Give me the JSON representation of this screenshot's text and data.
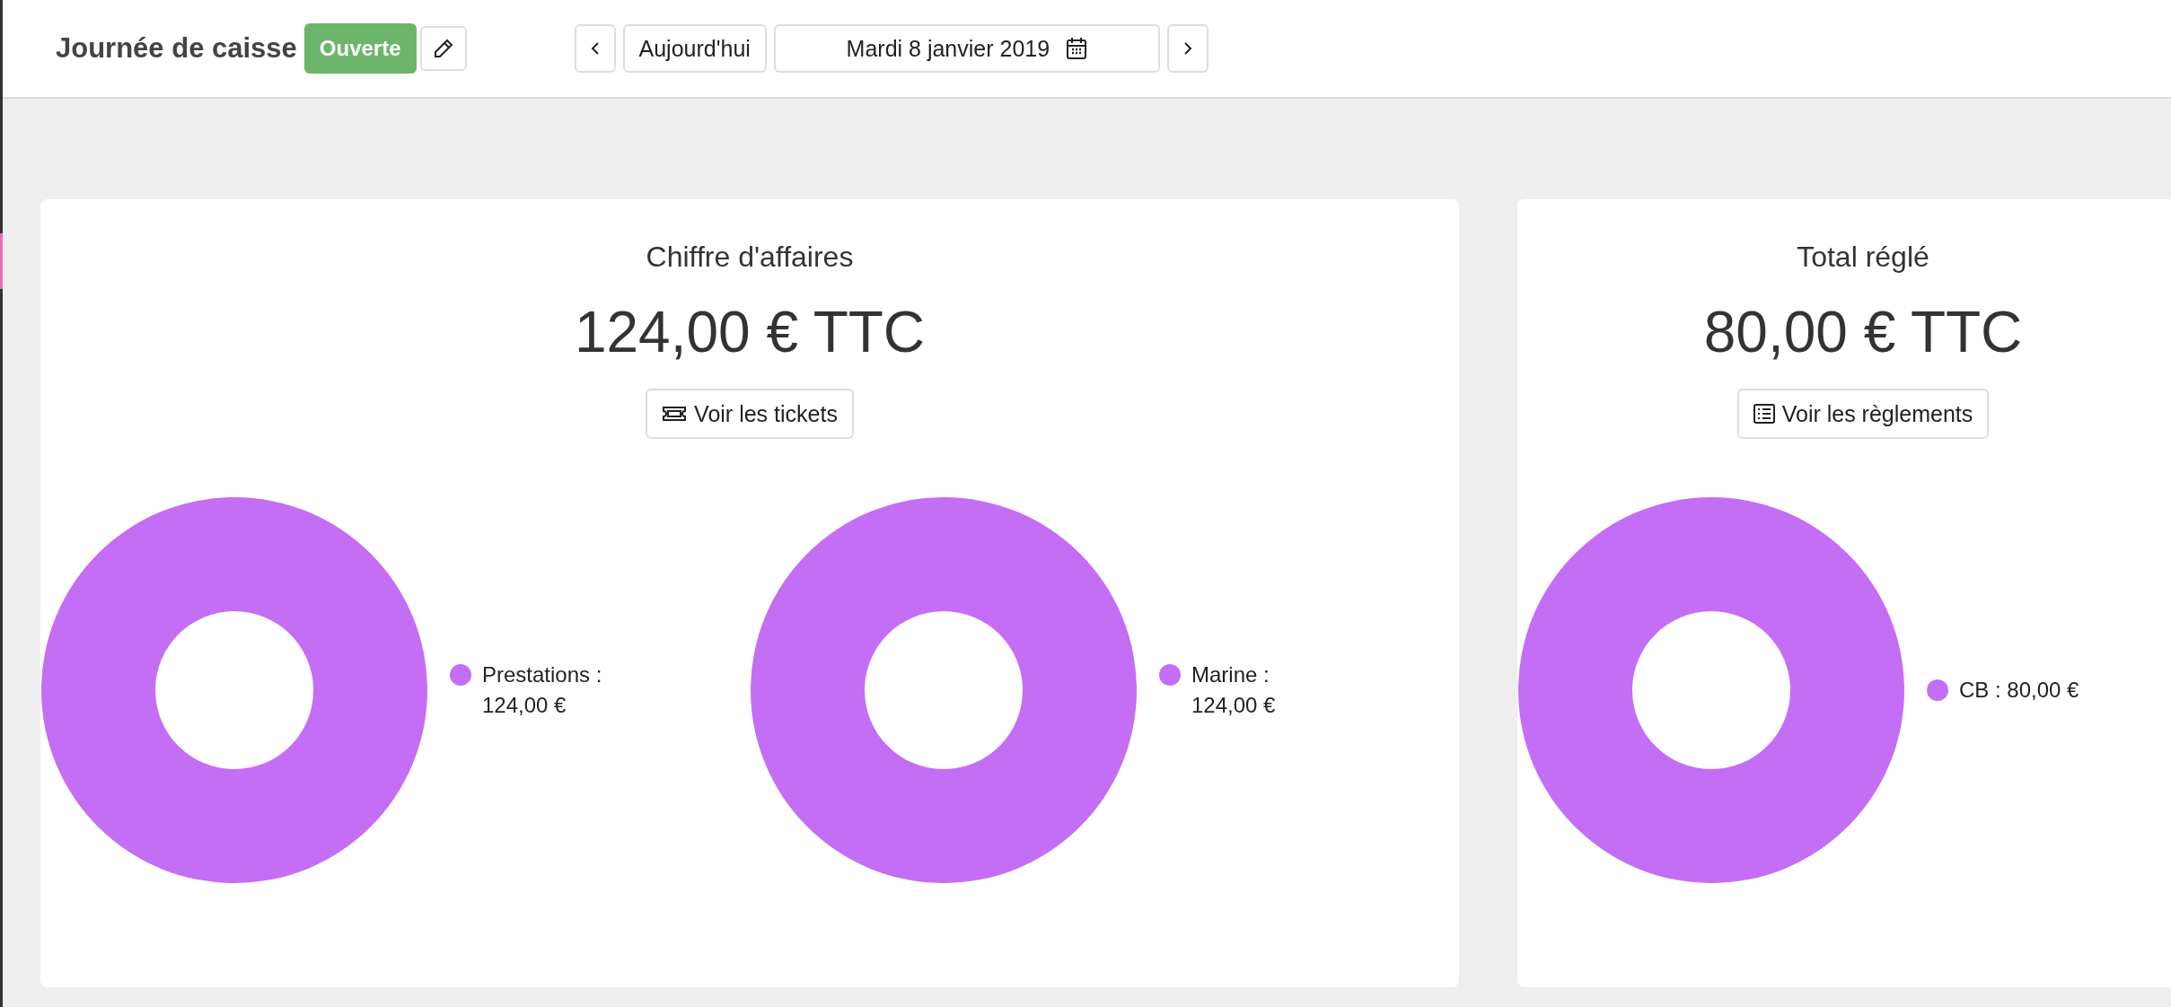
{
  "header": {
    "title": "Journée de caisse",
    "status": "Ouverte",
    "today_button": "Aujourd'hui",
    "date": "Mardi 8 janvier 2019"
  },
  "cards": [
    {
      "title": "Chiffre d'affaires",
      "amount": "124,00 € TTC",
      "button": "Voir les tickets",
      "charts": [
        {
          "legend": [
            {
              "label": "Prestations :",
              "value": "124,00 €",
              "color": "#c36ef5"
            }
          ]
        },
        {
          "legend": [
            {
              "label": "Marine :",
              "value": "124,00 €",
              "color": "#c36ef5"
            }
          ]
        }
      ]
    },
    {
      "title": "Total réglé",
      "amount": "80,00 € TTC",
      "button": "Voir les règlements",
      "charts": [
        {
          "legend": [
            {
              "label": "CB : 80,00 €",
              "color": "#c36ef5"
            }
          ]
        }
      ]
    }
  ]
}
